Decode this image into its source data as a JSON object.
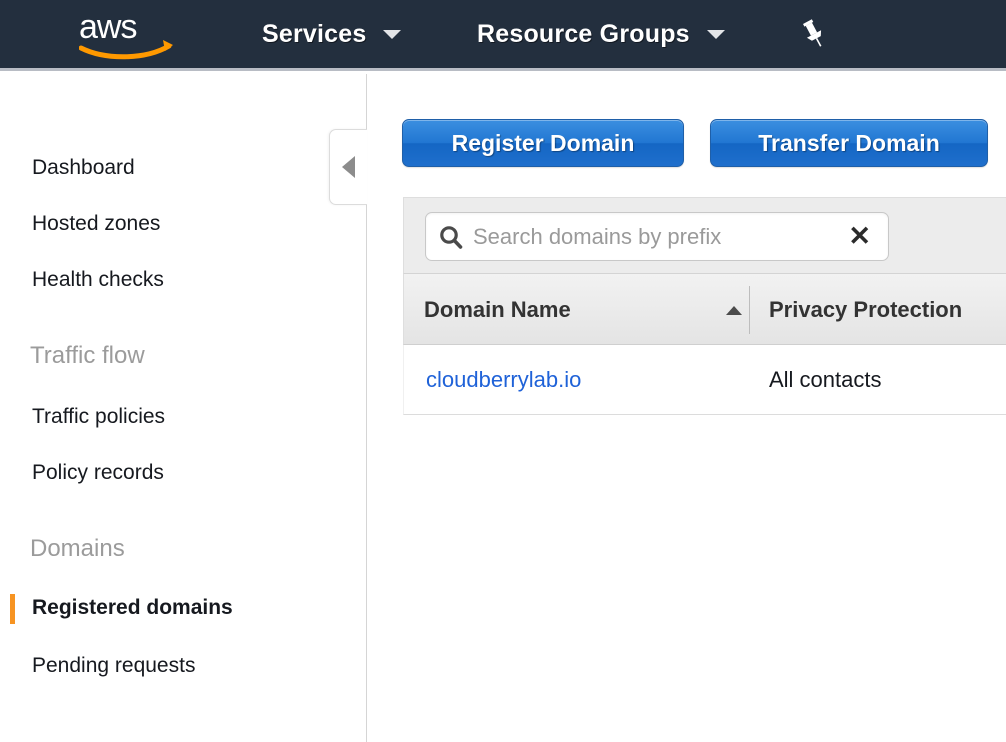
{
  "topnav": {
    "logo_alt": "aws",
    "items": [
      {
        "label": "Services",
        "icon": "chevron-down-icon"
      },
      {
        "label": "Resource Groups",
        "icon": "chevron-down-icon"
      }
    ],
    "pin_icon": "pushpin-icon",
    "colors": {
      "background": "#232f3e",
      "logo_arrow": "#ff9900"
    }
  },
  "sidebar": {
    "collapse_icon": "chevron-left-icon",
    "items": [
      {
        "label": "Dashboard",
        "type": "link",
        "active": false
      },
      {
        "label": "Hosted zones",
        "type": "link",
        "active": false
      },
      {
        "label": "Health checks",
        "type": "link",
        "active": false
      },
      {
        "label": "Traffic flow",
        "type": "section"
      },
      {
        "label": "Traffic policies",
        "type": "link",
        "active": false
      },
      {
        "label": "Policy records",
        "type": "link",
        "active": false
      },
      {
        "label": "Domains",
        "type": "section"
      },
      {
        "label": "Registered domains",
        "type": "link",
        "active": true
      },
      {
        "label": "Pending requests",
        "type": "link",
        "active": false
      }
    ],
    "active_color": "#f79422"
  },
  "main": {
    "buttons": {
      "register": "Register Domain",
      "transfer": "Transfer Domain"
    },
    "search": {
      "icon": "search-icon",
      "placeholder": "Search domains by prefix",
      "value": "",
      "clear_icon": "close-icon",
      "clear_label": "✕"
    },
    "table": {
      "columns": [
        {
          "label": "Domain Name",
          "sorted": "asc",
          "sort_icon": "sort-ascending-icon"
        },
        {
          "label": "Privacy Protection",
          "sorted": "none"
        }
      ],
      "rows": [
        {
          "domain_name": "cloudberrylab.io",
          "privacy_protection": "All contacts"
        }
      ]
    },
    "colors": {
      "link": "#1f62d8",
      "button": "#2176d2"
    }
  }
}
